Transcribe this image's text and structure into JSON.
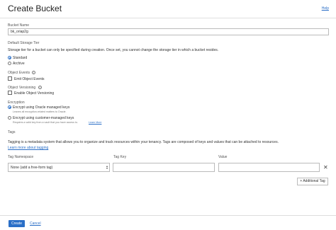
{
  "header": {
    "title": "Create Bucket",
    "help_link": "Help"
  },
  "bucket_name": {
    "label": "Bucket Name",
    "value": "bk_oriap2g"
  },
  "storage_tier": {
    "label": "Default Storage Tier",
    "description": "Storage tier for a bucket can only be specified during creation. Once set, you cannot change the storage tier in which a bucket resides.",
    "options": [
      {
        "label": "Standard",
        "selected": true
      },
      {
        "label": "Archive",
        "selected": false
      }
    ]
  },
  "object_events": {
    "label": "Object Events",
    "checkbox_label": "Emit Object Events"
  },
  "object_versioning": {
    "label": "Object Versioning",
    "checkbox_label": "Enable Object Versioning"
  },
  "encryption": {
    "label": "Encryption",
    "options": [
      {
        "label": "Encrypt using Oracle managed keys",
        "hint": "Leaves all encryption-related matters to Oracle.",
        "selected": true
      },
      {
        "label": "Encrypt using customer-managed keys",
        "hint": "Requires a valid key from a vault that you have access to.",
        "hint_link": "Learn More",
        "selected": false
      }
    ]
  },
  "tags": {
    "label": "Tags",
    "description": "Tagging is a metadata system that allows you to organize and track resources within your tenancy. Tags are composed of keys and values that can be attached to resources.",
    "learn_more": "Learn more about tagging",
    "col_namespace": "Tag Namespace",
    "col_key": "Tag Key",
    "col_value": "Value",
    "namespace_value": "None (add a free-form tag)",
    "key_value": "",
    "value_value": "",
    "add_button": "+ Additional Tag",
    "remove_icon": "close-icon"
  },
  "footer": {
    "create_button": "Create",
    "cancel_link": "Cancel"
  },
  "colors": {
    "accent": "#2b6fc7"
  }
}
